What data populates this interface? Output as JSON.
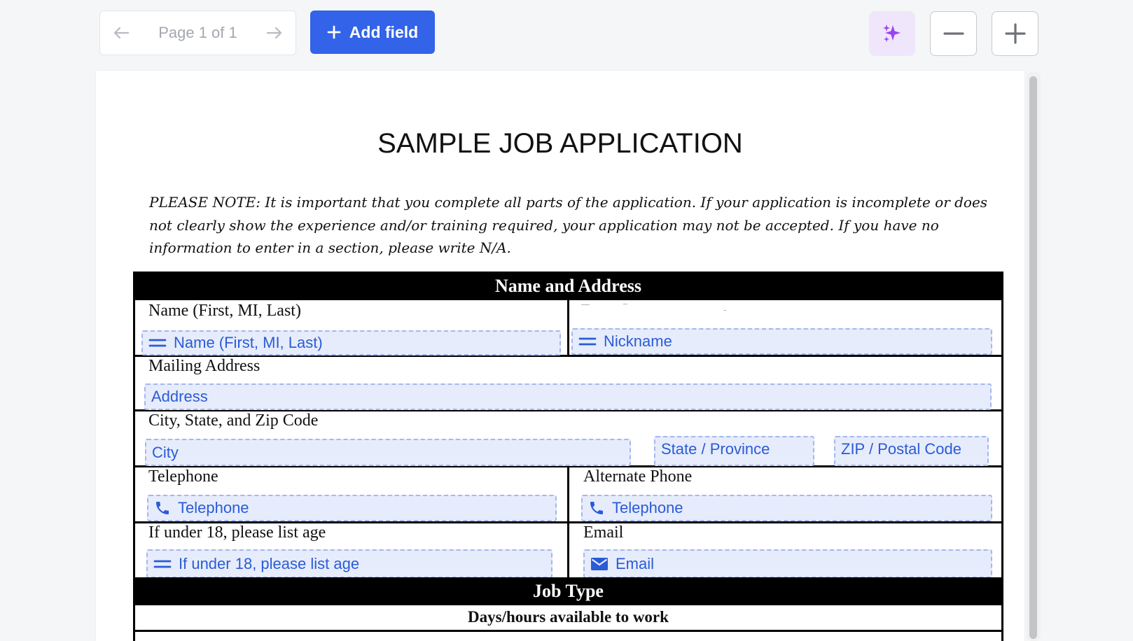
{
  "toolbar": {
    "pager_text": "Page 1 of 1",
    "add_field_label": "Add field",
    "icons": {
      "prev": "arrow-left-icon",
      "next": "arrow-right-icon",
      "add": "plus-icon",
      "magic": "sparkles-icon",
      "zoom_out": "minus-icon",
      "zoom_in": "plus-icon"
    },
    "colors": {
      "primary": "#3263e8",
      "magic_bg": "#efe6fb",
      "magic_icon": "#9b43f0"
    }
  },
  "document": {
    "title": "SAMPLE JOB APPLICATION",
    "note": "PLEASE NOTE: It is important that you complete all parts of the application.  If your application is incomplete or does not clearly show the experience and/or training required, your application may not be accepted.  If you have no information to enter in a section, please write N/A.",
    "sections": {
      "name_address": "Name and Address",
      "job_type": "Job Type"
    },
    "labels": {
      "name": "Name (First, MI, Last)",
      "mailing": "Mailing Address",
      "city_state_zip": "City, State, and Zip Code",
      "telephone": "Telephone",
      "alternate_phone": "Alternate Phone",
      "under18": "If under 18, please list age",
      "email": "Email",
      "days_hours": "Days/hours available to work"
    },
    "fields": {
      "name": "Name (First, MI, Last)",
      "nickname": "Nickname",
      "address": "Address",
      "city": "City",
      "state": "State / Province",
      "zip": "ZIP / Postal Code",
      "telephone": "Telephone",
      "alternate_phone": "Telephone",
      "under18": "If under 18, please list age",
      "email": "Email"
    },
    "field_icons": {
      "text": "text-lines-icon",
      "phone": "phone-icon",
      "email": "envelope-icon"
    },
    "colors": {
      "field_bg": "#e6ecfb",
      "field_border": "#a4b7ec",
      "field_text": "#2b5bd6"
    }
  }
}
